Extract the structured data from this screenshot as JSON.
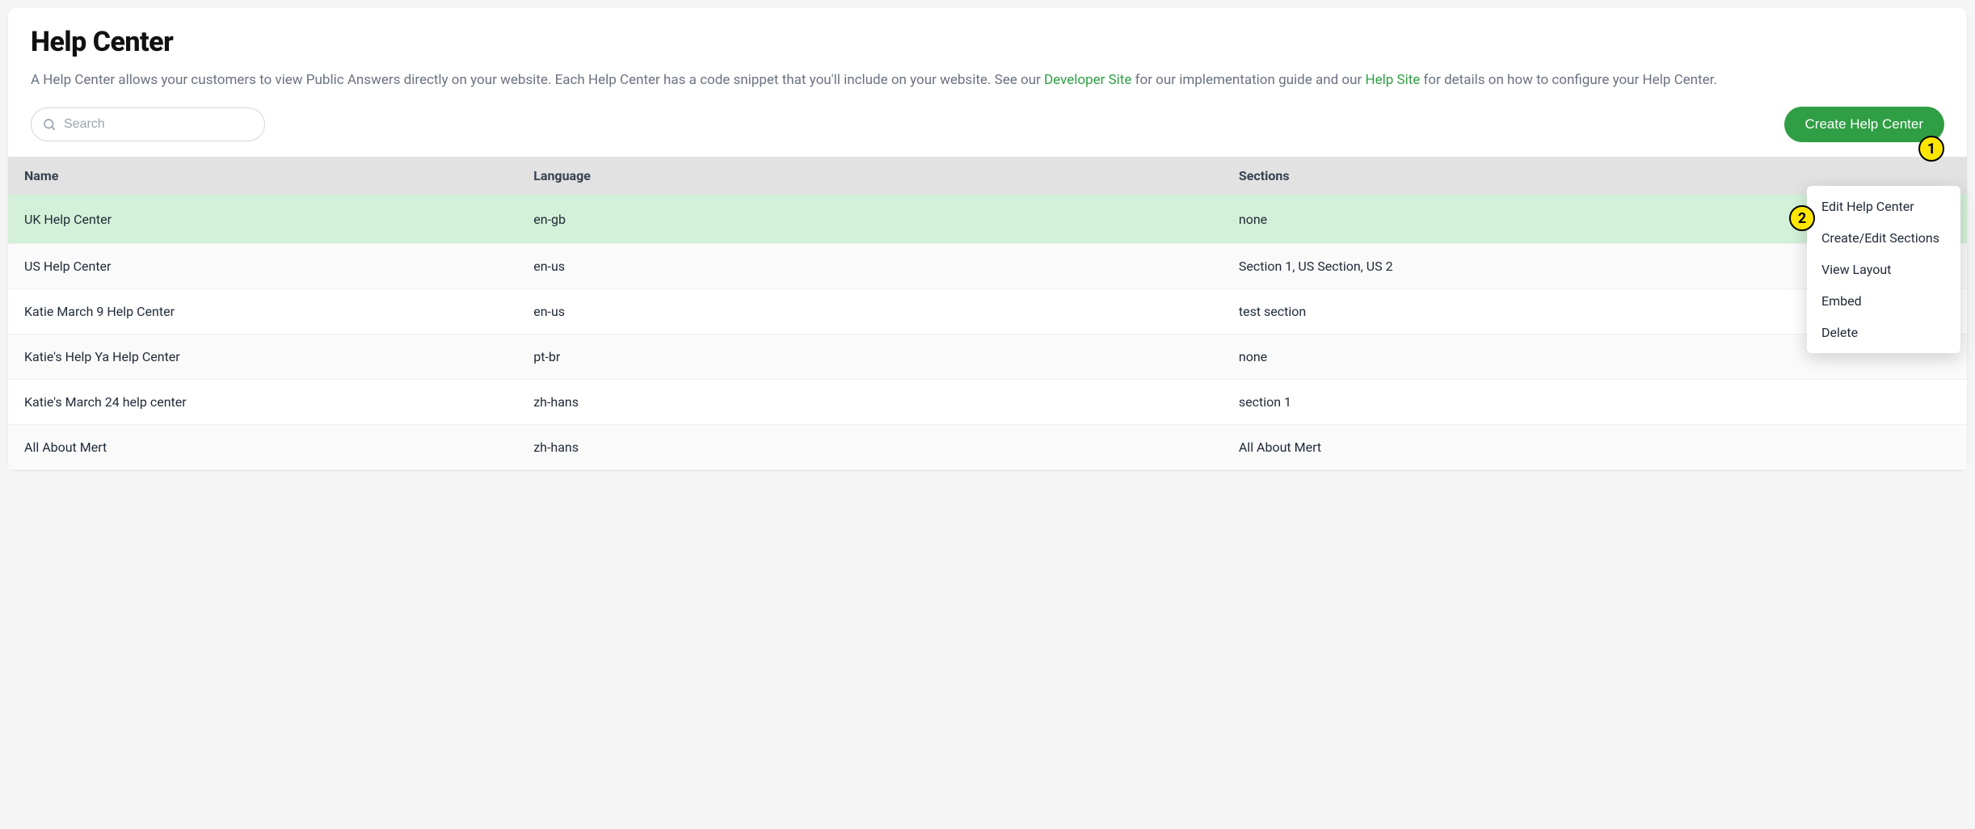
{
  "header": {
    "title": "Help Center",
    "desc_part1": "A Help Center allows your customers to view Public Answers directly on your website. Each Help Center has a code snippet that you'll include on your website. See our ",
    "dev_link": "Developer Site",
    "desc_part2": " for our implementation guide and our ",
    "help_link": "Help Site",
    "desc_part3": " for details on how to configure your Help Center."
  },
  "toolbar": {
    "search_placeholder": "Search",
    "create_label": "Create Help Center"
  },
  "table": {
    "columns": {
      "name": "Name",
      "language": "Language",
      "sections": "Sections"
    },
    "rows": [
      {
        "name": "UK Help Center",
        "language": "en-gb",
        "sections": "none",
        "highlighted": true,
        "show_menu": true
      },
      {
        "name": "US Help Center",
        "language": "en-us",
        "sections": "Section 1, US Section, US 2"
      },
      {
        "name": "Katie March 9 Help Center",
        "language": "en-us",
        "sections": "test section"
      },
      {
        "name": "Katie's Help Ya Help Center",
        "language": "pt-br",
        "sections": "none"
      },
      {
        "name": "Katie's March 24 help center",
        "language": "zh-hans",
        "sections": "section 1"
      },
      {
        "name": "All About Mert",
        "language": "zh-hans",
        "sections": "All About Mert"
      }
    ]
  },
  "context_menu": {
    "items": [
      "Edit Help Center",
      "Create/Edit Sections",
      "View Layout",
      "Embed",
      "Delete"
    ]
  },
  "annotations": {
    "b1": "1",
    "b2": "2"
  }
}
